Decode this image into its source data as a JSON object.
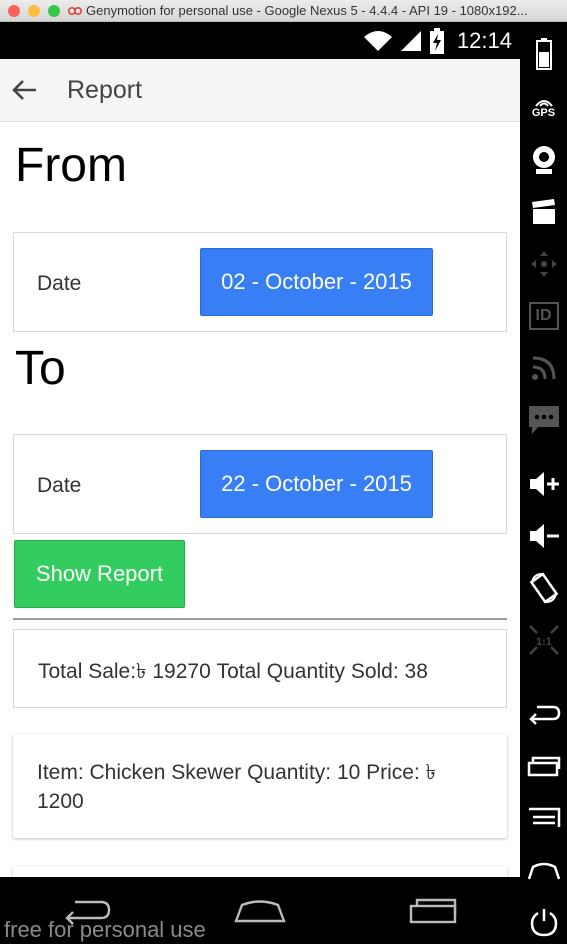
{
  "window": {
    "title": "Genymotion for personal use - Google Nexus 5 - 4.4.4 - API 19 - 1080x192..."
  },
  "statusbar": {
    "time": "12:14"
  },
  "appbar": {
    "title": "Report"
  },
  "from": {
    "heading": "From",
    "date_label": "Date",
    "date_value": "02 - October - 2015"
  },
  "to": {
    "heading": "To",
    "date_label": "Date",
    "date_value": "22 - October - 2015"
  },
  "show_report_label": "Show Report",
  "summary": {
    "text": "Total Sale:৳ 19270 Total Quantity Sold: 38"
  },
  "items": [
    {
      "text": "Item: Chicken Skewer Quantity: 10 Price: ৳ 1200"
    }
  ],
  "watermark": "free for personal use",
  "side_panel": {
    "gps_label": "GPS",
    "id_label": "ID",
    "scale_label": "1:1"
  },
  "colors": {
    "date_button": "#387ef5",
    "show_report_button": "#33cd5f"
  }
}
